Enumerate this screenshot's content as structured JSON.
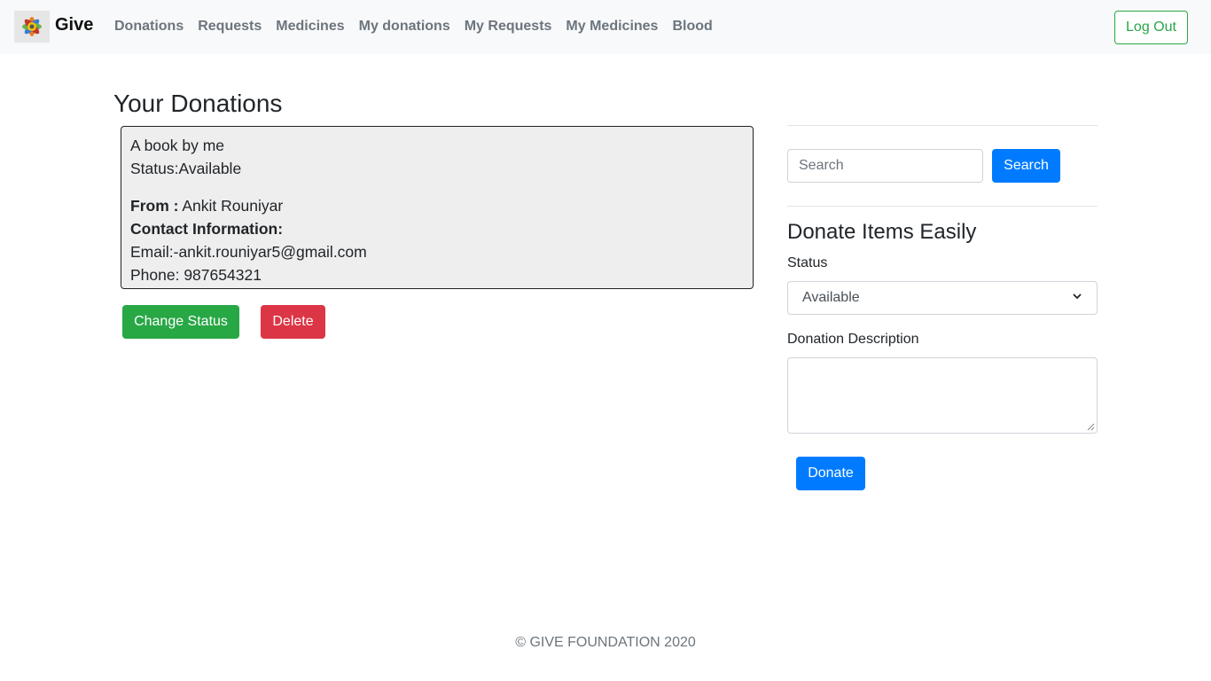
{
  "navbar": {
    "brand": "Give",
    "links": [
      "Donations",
      "Requests",
      "Medicines",
      "My donations",
      "My Requests",
      "My Medicines",
      "Blood"
    ],
    "logout_label": "Log Out"
  },
  "main": {
    "title": "Your Donations",
    "donation": {
      "description": "A book by me",
      "status": "Status:Available",
      "from_label": "From :",
      "from_name": "Ankit Rouniyar",
      "contact_label": "Contact Information:",
      "email": "Email:-ankit.rouniyar5@gmail.com",
      "phone": "Phone: 987654321"
    },
    "change_status_label": "Change Status",
    "delete_label": "Delete"
  },
  "sidebar": {
    "search": {
      "placeholder": "Search",
      "button_label": "Search"
    },
    "form": {
      "title": "Donate Items Easily",
      "status_label": "Status",
      "status_value": "Available",
      "description_label": "Donation Description",
      "description_value": "",
      "submit_label": "Donate"
    }
  },
  "footer": {
    "text": "© GIVE FOUNDATION 2020"
  },
  "colors": {
    "success": "#28a745",
    "danger": "#dc3545",
    "primary": "#007bff",
    "navbar_bg": "#f8f9fa",
    "card_bg": "#eeeeee"
  }
}
